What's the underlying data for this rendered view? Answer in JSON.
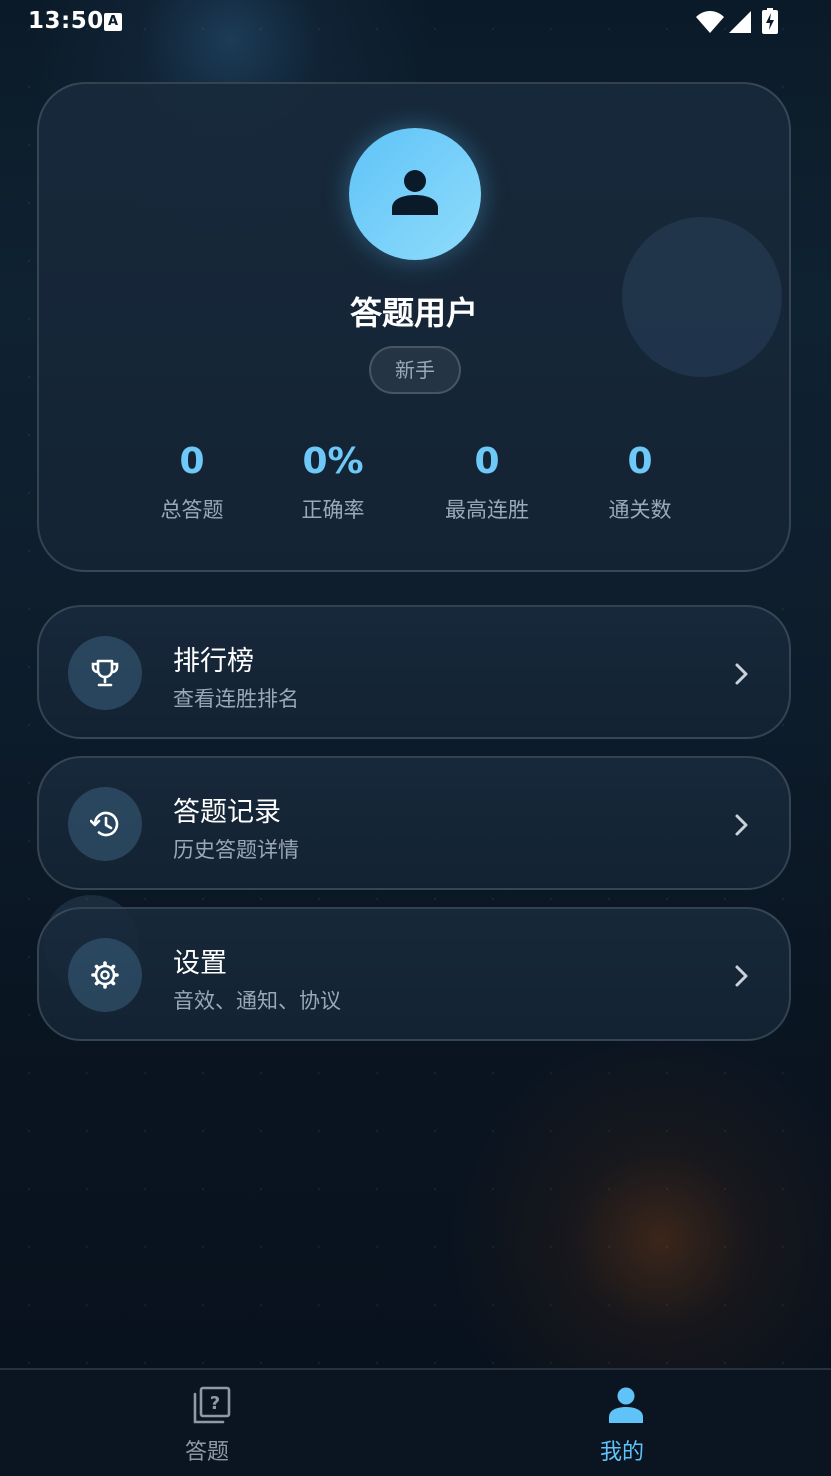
{
  "status_bar": {
    "time": "13:50",
    "notification_badge": "A",
    "icons": [
      "wifi-icon",
      "signal-icon",
      "battery-charging-icon"
    ]
  },
  "profile": {
    "username": "答题用户",
    "level": "新手",
    "avatar_icon": "user-icon",
    "stats": [
      {
        "value": "0",
        "label": "总答题"
      },
      {
        "value": "0%",
        "label": "正确率"
      },
      {
        "value": "0",
        "label": "最高连胜"
      },
      {
        "value": "0",
        "label": "通关数"
      }
    ]
  },
  "menu": [
    {
      "title": "排行榜",
      "subtitle": "查看连胜排名",
      "icon": "trophy-icon"
    },
    {
      "title": "答题记录",
      "subtitle": "历史答题详情",
      "icon": "history-icon"
    },
    {
      "title": "设置",
      "subtitle": "音效、通知、协议",
      "icon": "gear-icon"
    }
  ],
  "bottom_nav": {
    "items": [
      {
        "label": "答题",
        "icon": "quiz-icon",
        "active": false
      },
      {
        "label": "我的",
        "icon": "person-icon",
        "active": true
      }
    ]
  },
  "colors": {
    "accent": "#6ec8f8",
    "active_tab": "#5fc3f8",
    "inactive_tab": "#8e9aa6",
    "background": "#0d1c2b"
  }
}
